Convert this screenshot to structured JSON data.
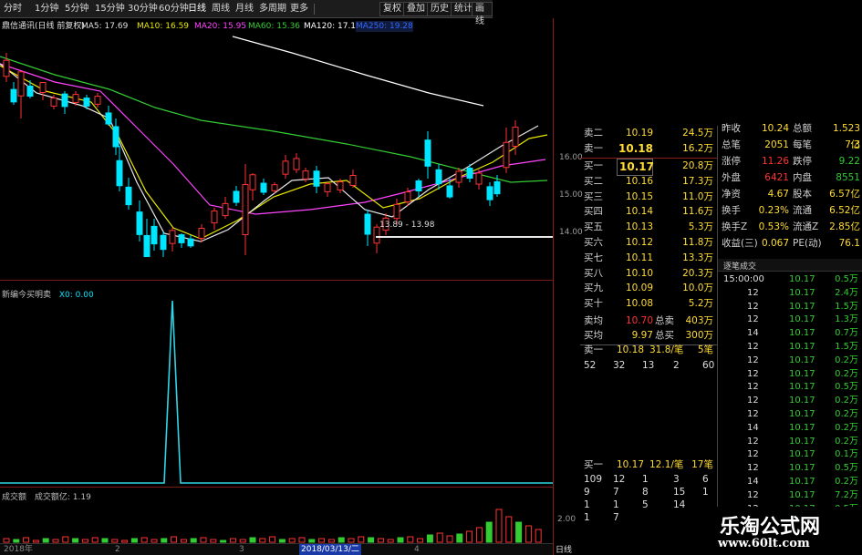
{
  "toolbar": {
    "periods": [
      "分时",
      "1分钟",
      "5分钟",
      "15分钟",
      "30分钟",
      "60分钟",
      "日线",
      "周线",
      "月线",
      "多周期",
      "更多"
    ],
    "active_period": "日线",
    "buttons": [
      "复权",
      "叠加",
      "历史",
      "统计",
      "画线"
    ]
  },
  "ma_bar": {
    "title": "鼎信通讯(日线 前复权)",
    "ma5": "MA5: 17.69",
    "ma10": "MA10: 16.59",
    "ma20": "MA20: 15.95",
    "ma60": "MA60: 15.36",
    "ma120": "MA120: 17.12",
    "ma250": "MA250: 19.28"
  },
  "price_axis": [
    "16.00",
    "15.00",
    "14.00"
  ],
  "range_annotation": "13.89 - 13.98",
  "indicator": {
    "title": "新编今买明卖",
    "value": "X0: 0.00"
  },
  "volume": {
    "title": "成交额",
    "value": "成交额亿: 1.19",
    "axis": "2.00"
  },
  "dates": {
    "d1": "2018年",
    "d2": "2",
    "d3": "3",
    "d4": "4",
    "selected": "2018/03/13/二"
  },
  "colors": {
    "up": "#ff3333",
    "down": "#00e5ff",
    "ma5": "#e8e8e8",
    "ma10": "#e6e600",
    "ma20": "#ff44ff",
    "ma60": "#33cc33",
    "ma120": "#ffffff",
    "ma250": "#3366ff",
    "price": "#ffdd33"
  },
  "order_book": {
    "sells": [
      {
        "label": "卖二",
        "price": "10.19",
        "vol": "24.5万"
      },
      {
        "label": "卖一",
        "price": "10.18",
        "vol": "16.2万"
      }
    ],
    "buys": [
      {
        "label": "买一",
        "price": "10.17",
        "vol": "20.8万"
      },
      {
        "label": "买二",
        "price": "10.16",
        "vol": "17.3万"
      },
      {
        "label": "买三",
        "price": "10.15",
        "vol": "11.0万"
      },
      {
        "label": "买四",
        "price": "10.14",
        "vol": "11.6万"
      },
      {
        "label": "买五",
        "price": "10.13",
        "vol": "5.3万"
      },
      {
        "label": "买六",
        "price": "10.12",
        "vol": "11.8万"
      },
      {
        "label": "买七",
        "price": "10.11",
        "vol": "13.3万"
      },
      {
        "label": "买八",
        "price": "10.10",
        "vol": "20.3万"
      },
      {
        "label": "买九",
        "price": "10.09",
        "vol": "10.0万"
      },
      {
        "label": "买十",
        "price": "10.08",
        "vol": "5.2万"
      }
    ],
    "sell_avg": {
      "label": "卖均",
      "price": "10.70",
      "total_label": "总卖",
      "total": "403万"
    },
    "buy_avg": {
      "label": "买均",
      "price": "9.97",
      "total_label": "总买",
      "total": "300万"
    },
    "sell_queue": {
      "label": "卖一",
      "price": "10.18",
      "vol": "31.8/笔",
      "count": "5笔",
      "items": [
        "52",
        "32",
        "13",
        "2",
        "60"
      ]
    },
    "buy_queue": {
      "label": "买一",
      "price": "10.17",
      "vol": "12.1/笔",
      "count": "17笔",
      "rows": [
        [
          "109",
          "12",
          "1",
          "3",
          "6"
        ],
        [
          "9",
          "7",
          "8",
          "15",
          "1"
        ],
        [
          "1",
          "1",
          "5",
          "14",
          ""
        ],
        [
          "1",
          "7",
          "",
          "",
          ""
        ]
      ]
    }
  },
  "stats": [
    {
      "l1": "昨收",
      "v1": "10.24",
      "l2": "总额",
      "v2": "1.523亿"
    },
    {
      "l1": "总笔",
      "v1": "2051",
      "l2": "每笔",
      "v2": "7.3"
    },
    {
      "l1": "涨停",
      "v1": "11.26",
      "l2": "跌停",
      "v2": "9.22"
    },
    {
      "l1": "外盘",
      "v1": "6421",
      "l2": "内盘",
      "v2": "8551"
    },
    {
      "l1": "净资",
      "v1": "4.67",
      "l2": "股本",
      "v2": "6.57亿"
    },
    {
      "l1": "换手",
      "v1": "0.23%",
      "l2": "流通",
      "v2": "6.52亿"
    },
    {
      "l1": "换手Z",
      "v1": "0.53%",
      "l2": "流通Z",
      "v2": "2.85亿"
    },
    {
      "l1": "收益(三)",
      "v1": "0.067",
      "l2": "PE(动)",
      "v2": "76.1"
    }
  ],
  "ticks": {
    "title": "逐笔成交",
    "rows": [
      {
        "t": "15:00:00",
        "p": "10.17",
        "v": "0.5万"
      },
      {
        "t": "12",
        "p": "10.17",
        "v": "2.4万"
      },
      {
        "t": "12",
        "p": "10.17",
        "v": "1.5万"
      },
      {
        "t": "12",
        "p": "10.17",
        "v": "1.3万"
      },
      {
        "t": "14",
        "p": "10.17",
        "v": "0.7万"
      },
      {
        "t": "12",
        "p": "10.17",
        "v": "1.5万"
      },
      {
        "t": "12",
        "p": "10.17",
        "v": "0.2万"
      },
      {
        "t": "12",
        "p": "10.17",
        "v": "0.2万"
      },
      {
        "t": "12",
        "p": "10.17",
        "v": "0.5万"
      },
      {
        "t": "12",
        "p": "10.17",
        "v": "0.2万"
      },
      {
        "t": "12",
        "p": "10.17",
        "v": "0.2万"
      },
      {
        "t": "14",
        "p": "10.17",
        "v": "0.2万"
      },
      {
        "t": "12",
        "p": "10.17",
        "v": "0.2万"
      },
      {
        "t": "12",
        "p": "10.17",
        "v": "0.1万"
      },
      {
        "t": "12",
        "p": "10.17",
        "v": "0.5万"
      },
      {
        "t": "14",
        "p": "10.17",
        "v": "0.2万"
      },
      {
        "t": "12",
        "p": "10.17",
        "v": "7.2万"
      },
      {
        "t": "12",
        "p": "10.17",
        "v": "0.5万"
      },
      {
        "t": "25",
        "p": "10.17",
        "v": "0.5万"
      }
    ]
  },
  "watermark": {
    "name": "乐淘公式网",
    "url": "www.60lt.com"
  }
}
